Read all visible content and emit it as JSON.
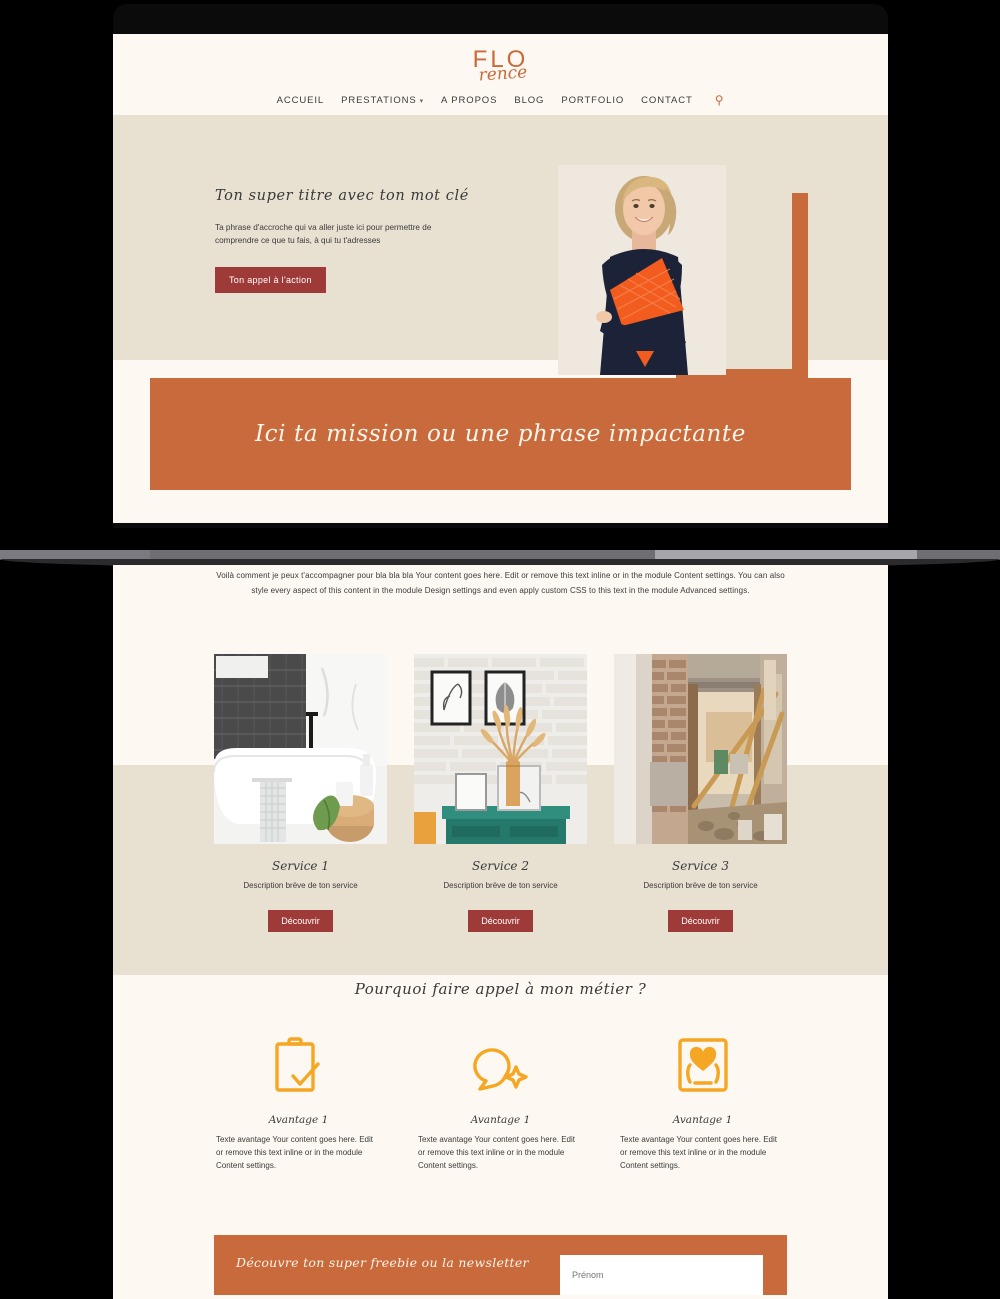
{
  "brand": {
    "logo_primary": "FLO",
    "logo_script": "rence",
    "accent": "#C96A3C",
    "dark_red": "#9E3B38",
    "cream": "#FDF8F2",
    "beige": "#E8E0D1",
    "yellow": "#F5A623"
  },
  "nav": {
    "items": [
      {
        "label": "ACCUEIL",
        "has_caret": false
      },
      {
        "label": "PRESTATIONS",
        "has_caret": true
      },
      {
        "label": "A PROPOS",
        "has_caret": false
      },
      {
        "label": "BLOG",
        "has_caret": false
      },
      {
        "label": "PORTFOLIO",
        "has_caret": false
      },
      {
        "label": "CONTACT",
        "has_caret": false
      }
    ],
    "search_icon": "search-icon"
  },
  "hero": {
    "title": "Ton super titre avec ton mot clé",
    "subtitle": "Ta phrase d'accroche qui va aller juste ici pour permettre de comprendre ce que tu fais, à qui tu t'adresses",
    "cta": "Ton appel à l'action",
    "image_alt": "smiling-woman-holding-orange-folder"
  },
  "mission": {
    "text": "Ici ta mission ou une phrase impactante"
  },
  "intro": {
    "paragraph": "Voilà comment je peux t'accompagner pour bla bla bla Your content goes here. Edit or remove this text inline or in the module Content settings. You can also style every aspect of this content in the module Design settings and even apply custom CSS to this text in the module Advanced settings."
  },
  "services": {
    "items": [
      {
        "title": "Service 1",
        "description": "Description brève de ton service",
        "button": "Découvrir",
        "image_alt": "white-bathtub-grey-herringbone-tile-bathroom"
      },
      {
        "title": "Service 2",
        "description": "Description brève de ton service",
        "button": "Découvrir",
        "image_alt": "green-console-table-pampas-vase-brick-wall"
      },
      {
        "title": "Service 3",
        "description": "Description brève de ton service",
        "button": "Découvrir",
        "image_alt": "interior-renovation-construction-site"
      }
    ]
  },
  "why": {
    "heading": "Pourquoi faire appel à mon métier ?",
    "advantages": [
      {
        "icon": "clipboard-check-icon",
        "title": "Avantage 1",
        "text": "Texte avantage Your content goes here. Edit or remove this text inline or in the module Content settings."
      },
      {
        "icon": "speech-bubble-sparkle-icon",
        "title": "Avantage 1",
        "text": "Texte avantage Your content goes here. Edit or remove this text inline or in the module Content settings."
      },
      {
        "icon": "heart-in-hands-icon",
        "title": "Avantage 1",
        "text": "Texte avantage Your content goes here. Edit or remove this text inline or in the module Content settings."
      }
    ]
  },
  "newsletter": {
    "title": "Découvre ton super freebie ou la newsletter",
    "input_placeholder": "Prénom"
  }
}
